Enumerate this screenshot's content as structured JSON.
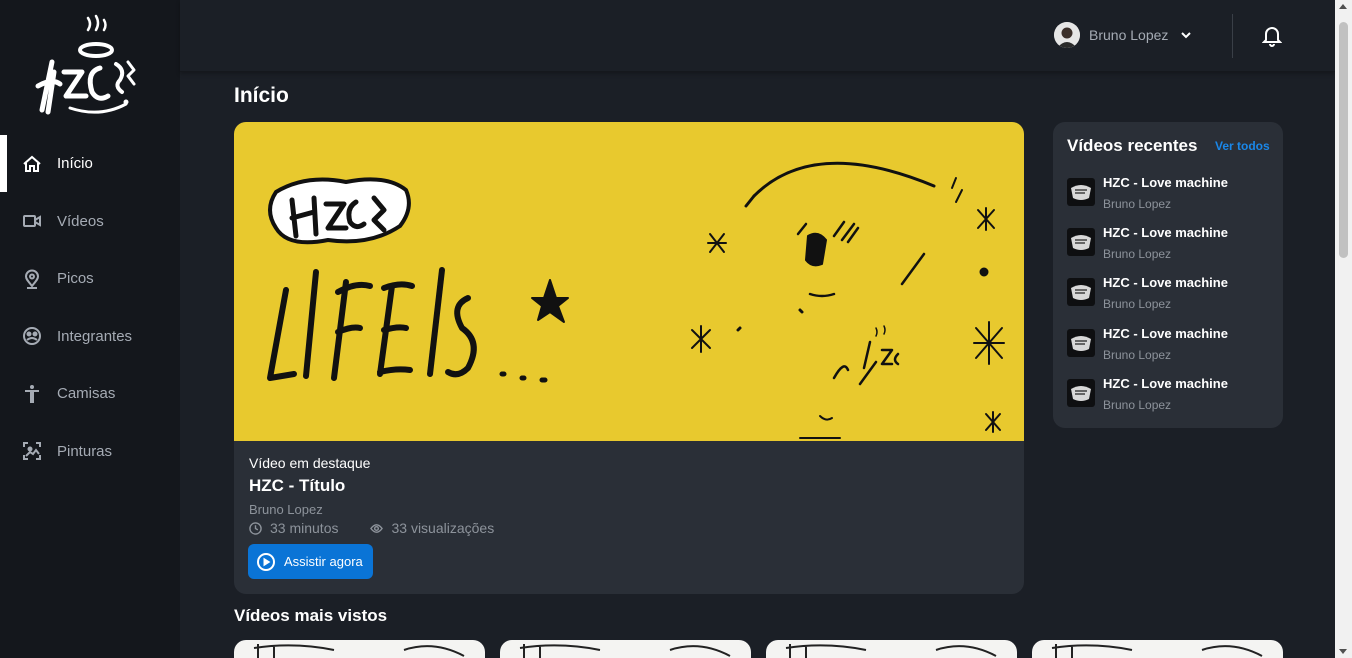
{
  "sidebar": {
    "items": [
      {
        "label": "Início",
        "icon": "home-icon"
      },
      {
        "label": "Vídeos",
        "icon": "video-camera-icon"
      },
      {
        "label": "Picos",
        "icon": "map-pin-icon"
      },
      {
        "label": "Integrantes",
        "icon": "group-icon"
      },
      {
        "label": "Camisas",
        "icon": "person-icon"
      },
      {
        "label": "Pinturas",
        "icon": "image-icon"
      }
    ]
  },
  "header": {
    "user_name": "Bruno Lopez"
  },
  "main": {
    "title": "Início",
    "featured": {
      "label": "Vídeo em destaque",
      "title": "HZC - Título",
      "author": "Bruno Lopez",
      "duration": "33 minutos",
      "views": "33 visualizações",
      "button": "Assistir agora"
    },
    "recent": {
      "title": "Vídeos recentes",
      "see_all": "Ver todos",
      "items": [
        {
          "title": "HZC - Love machine",
          "author": "Bruno Lopez"
        },
        {
          "title": "HZC - Love machine",
          "author": "Bruno Lopez"
        },
        {
          "title": "HZC - Love machine",
          "author": "Bruno Lopez"
        },
        {
          "title": "HZC - Love machine",
          "author": "Bruno Lopez"
        },
        {
          "title": "HZC - Love machine",
          "author": "Bruno Lopez"
        }
      ]
    },
    "most_viewed": {
      "title": "Vídeos mais vistos"
    }
  },
  "colors": {
    "accent": "#0a74d6",
    "link": "#1a87e8",
    "banner": "#e8c92e"
  }
}
